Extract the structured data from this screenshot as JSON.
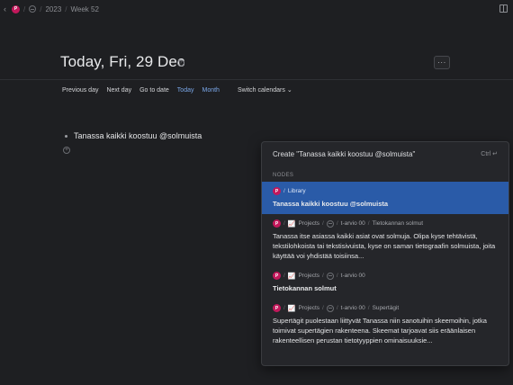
{
  "topbar": {
    "avatar_letter": "P",
    "year": "2023",
    "week": "Week 52"
  },
  "page": {
    "title": "Today, Fri, 29 Dec",
    "more": "···"
  },
  "nav": {
    "previous_day": "Previous day",
    "next_day": "Next day",
    "go_to_date": "Go to date",
    "today": "Today",
    "month": "Month",
    "switch_calendars": "Switch calendars"
  },
  "content": {
    "bullet": "Tanassa kaikki koostuu @solmuista"
  },
  "popup": {
    "create_label": "Create \"Tanassa kaikki koostuu @solmuista\"",
    "shortcut": "Ctrl ↵",
    "section": "NODES",
    "results": [
      {
        "crumbs": [
          "Library"
        ],
        "title": "Tanassa kaikki koostuu @solmuista",
        "body": ""
      },
      {
        "crumbs": [
          "Projects",
          "t-arvio 00",
          "Tietokannan solmut"
        ],
        "title": "",
        "body": "Tanassa itse asiassa kaikki asiat ovat solmuja. Olipa kyse tehtävistä, tekstilohkoista tai tekstisivuista, kyse on saman tietograafin solmuista, joita käyttää voi yhdistää toisiinsa..."
      },
      {
        "crumbs": [
          "Projects",
          "",
          "t-arvio 00"
        ],
        "title": "Tietokannan solmut",
        "body": ""
      },
      {
        "crumbs": [
          "Projects",
          "t-arvio 00",
          "Supertägit"
        ],
        "title": "",
        "body": "Supertägit puolestaan liittyvät Tanassa niin sanotuihin skeemoihin, jotka toimivat supertägien rakenteena. Skeemat tarjoavat siis eräänlaisen rakenteellisen perustan tietotyyppien ominaisuuksie..."
      }
    ]
  }
}
